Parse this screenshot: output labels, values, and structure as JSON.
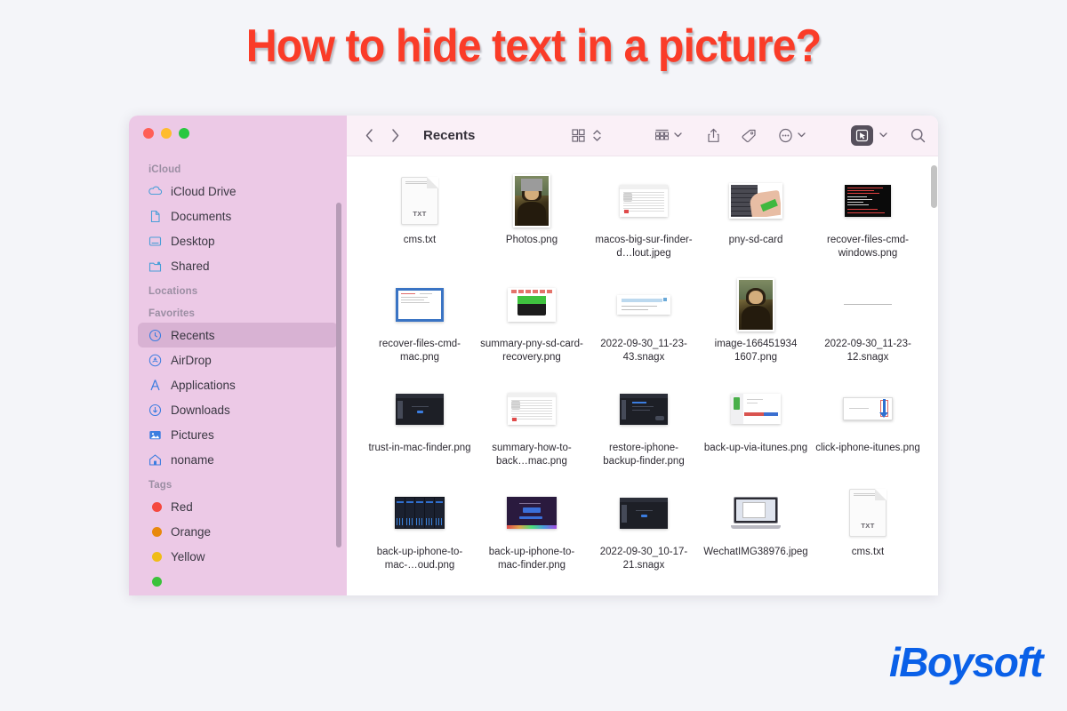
{
  "headline": "How to hide text in a picture?",
  "brand": {
    "logo_text": "iBoysoft",
    "accent_color": "#0a60e8",
    "headline_color": "#fa3c28"
  },
  "window": {
    "traffic_lights": [
      {
        "name": "close",
        "color": "#ff5f57"
      },
      {
        "name": "minimize",
        "color": "#febc2e"
      },
      {
        "name": "maximize",
        "color": "#28c840"
      }
    ]
  },
  "toolbar": {
    "title": "Recents",
    "back_label": "‹",
    "forward_label": "›",
    "icons": [
      "back-arrow-icon",
      "forward-arrow-icon",
      "icon-view-icon",
      "sort-chevrons-icon",
      "group-by-icon",
      "chevron-down-icon",
      "share-icon",
      "tag-icon",
      "more-actions-icon",
      "chevron-down-icon",
      "quick-action-icon",
      "chevron-down-icon",
      "search-icon"
    ]
  },
  "sidebar": {
    "sections": [
      {
        "heading": "iCloud",
        "items": [
          {
            "label": "iCloud Drive",
            "icon": "cloud-icon"
          },
          {
            "label": "Documents",
            "icon": "document-icon"
          },
          {
            "label": "Desktop",
            "icon": "desktop-icon"
          },
          {
            "label": "Shared",
            "icon": "shared-folder-icon"
          }
        ]
      },
      {
        "heading": "Locations",
        "items": []
      },
      {
        "heading": "Favorites",
        "items": [
          {
            "label": "Recents",
            "icon": "clock-icon",
            "selected": true
          },
          {
            "label": "AirDrop",
            "icon": "airdrop-icon"
          },
          {
            "label": "Applications",
            "icon": "applications-icon"
          },
          {
            "label": "Downloads",
            "icon": "download-icon"
          },
          {
            "label": "Pictures",
            "icon": "pictures-icon"
          },
          {
            "label": "noname",
            "icon": "home-icon"
          }
        ]
      },
      {
        "heading": "Tags",
        "items": [
          {
            "label": "Red",
            "icon": "tag-dot-icon",
            "color": "#f5483f"
          },
          {
            "label": "Orange",
            "icon": "tag-dot-icon",
            "color": "#e8890c"
          },
          {
            "label": "Yellow",
            "icon": "tag-dot-icon",
            "color": "#f0bc17"
          },
          {
            "label": "",
            "icon": "tag-dot-icon",
            "color": "#3bc23b"
          }
        ]
      }
    ]
  },
  "files": [
    {
      "name": "cms.txt",
      "thumb": "txt-document"
    },
    {
      "name": "Photos.png",
      "thumb": "mona-lisa-redacted"
    },
    {
      "name": "macos-big-sur-finder-d…lout.jpeg",
      "thumb": "screenshot-light"
    },
    {
      "name": "pny-sd-card",
      "thumb": "sd-card-photo"
    },
    {
      "name": "recover-files-cmd-windows.png",
      "thumb": "terminal-red"
    },
    {
      "name": "recover-files-cmd-mac.png",
      "thumb": "window-blue"
    },
    {
      "name": "summary-pny-sd-card-recovery.png",
      "thumb": "sd-card-green"
    },
    {
      "name": "2022-09-30_11-23-43.snagx",
      "thumb": "snagit-clip"
    },
    {
      "name": "image-166451934 1607.png",
      "thumb": "mona-lisa"
    },
    {
      "name": "2022-09-30_11-23-12.snagx",
      "thumb": "thin-line-clip"
    },
    {
      "name": "trust-in-mac-finder.png",
      "thumb": "dark-finder"
    },
    {
      "name": "summary-how-to-back…mac.png",
      "thumb": "screenshot-light"
    },
    {
      "name": "restore-iphone-backup-finder.png",
      "thumb": "dark-finder-2"
    },
    {
      "name": "back-up-via-itunes.png",
      "thumb": "itunes-window"
    },
    {
      "name": "click-iphone-itunes.png",
      "thumb": "click-itunes"
    },
    {
      "name": "back-up-iphone-to-mac-…oud.png",
      "thumb": "phone-grid"
    },
    {
      "name": "back-up-iphone-to-mac-finder.png",
      "thumb": "purple-shot"
    },
    {
      "name": "2022-09-30_10-17-21.snagx",
      "thumb": "dark-finder"
    },
    {
      "name": "WechatIMG38976.jpeg",
      "thumb": "macbook-photo"
    },
    {
      "name": "cms.txt",
      "thumb": "txt-document"
    }
  ],
  "txt_icon_label": "TXT"
}
